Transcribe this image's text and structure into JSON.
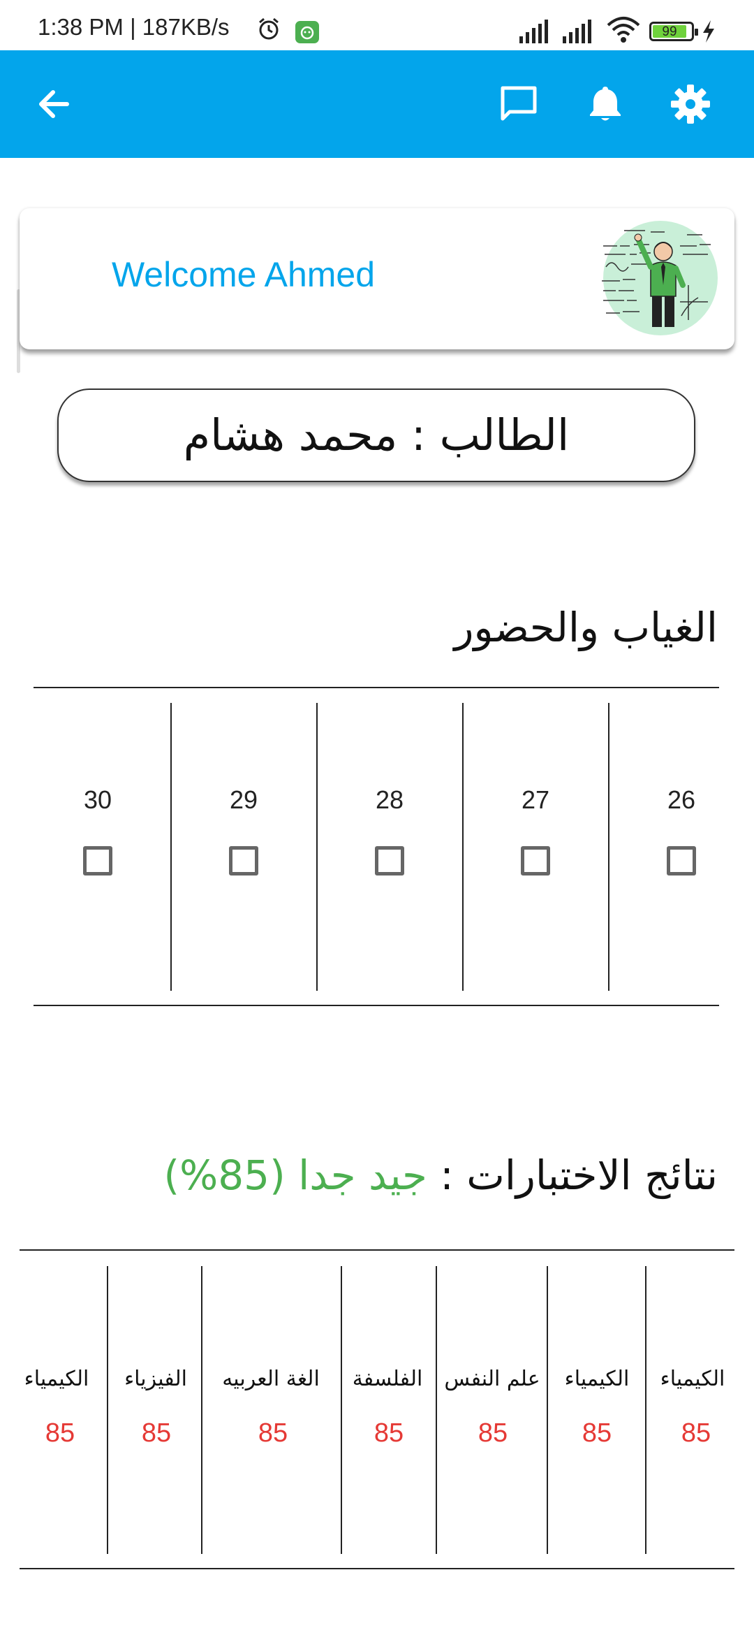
{
  "status_bar": {
    "time_speed": "1:38 PM | 187KB/s",
    "battery_level": "99",
    "icons": [
      "alarm-icon",
      "app-notification-icon",
      "signal-icon",
      "signal-icon",
      "wifi-icon",
      "battery-icon",
      "charging-icon"
    ]
  },
  "app_bar": {
    "color": "#03a5eb",
    "icons": [
      "back-arrow-icon",
      "chat-icon",
      "bell-icon",
      "gear-icon"
    ]
  },
  "welcome": {
    "greeting": "Welcome Ahmed",
    "illustration": "teacher-at-board-illustration"
  },
  "student": {
    "label": "الطالب : محمد هشام"
  },
  "attendance": {
    "title": "الغياب والحضور",
    "days": [
      {
        "day": "26",
        "checked": false
      },
      {
        "day": "27",
        "checked": false
      },
      {
        "day": "28",
        "checked": false
      },
      {
        "day": "29",
        "checked": false
      },
      {
        "day": "30",
        "checked": false
      }
    ]
  },
  "results": {
    "title": "نتائج الاختبارات :",
    "grade": "جيد جدا (85%)",
    "subjects": [
      {
        "name": "الكيمياء",
        "score": "85"
      },
      {
        "name": "الكيمياء",
        "score": "85"
      },
      {
        "name": "علم النفس",
        "score": "85"
      },
      {
        "name": "الفلسفة",
        "score": "85"
      },
      {
        "name": "الغة العربيه",
        "score": "85"
      },
      {
        "name": "الفيزياء",
        "score": "85"
      },
      {
        "name": "الكيمياء",
        "score": "85"
      }
    ]
  },
  "colors": {
    "accent": "#03a5eb",
    "grade_green": "#4caf50",
    "score_red": "#e53935"
  }
}
